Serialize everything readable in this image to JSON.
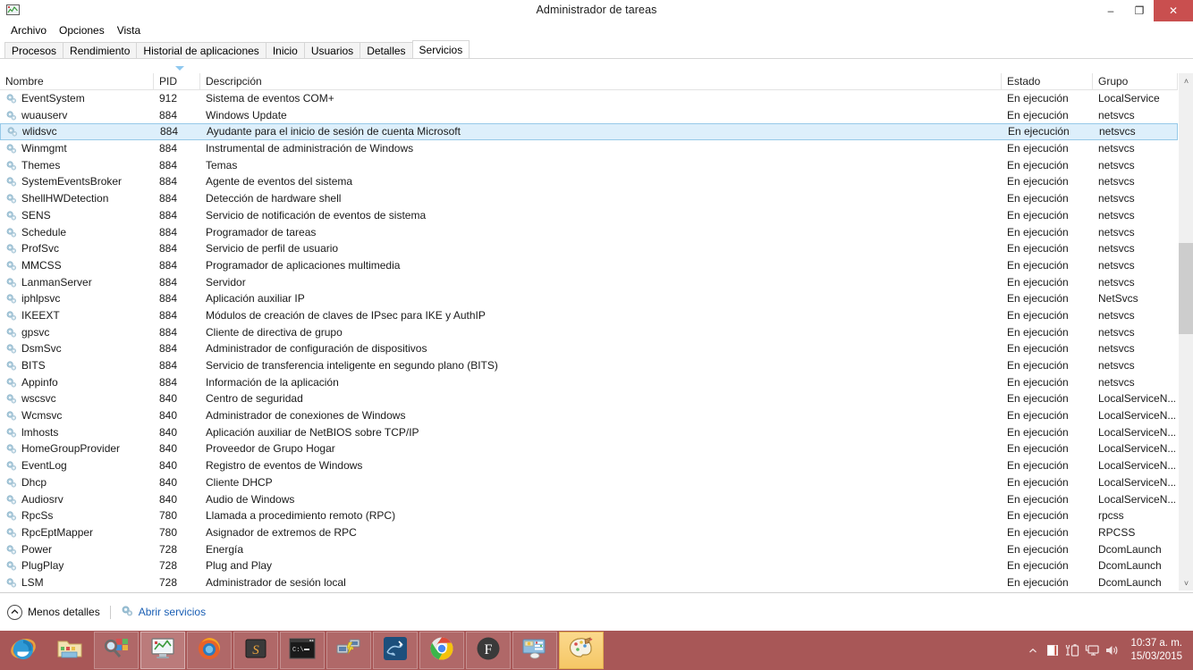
{
  "window": {
    "title": "Administrador de tareas",
    "icon": "task-manager-icon",
    "minimize_label": "–",
    "maximize_label": "❐",
    "close_label": "✕"
  },
  "menubar": {
    "items": [
      {
        "label": "Archivo"
      },
      {
        "label": "Opciones"
      },
      {
        "label": "Vista"
      }
    ]
  },
  "tabs": [
    {
      "label": "Procesos",
      "active": false
    },
    {
      "label": "Rendimiento",
      "active": false
    },
    {
      "label": "Historial de aplicaciones",
      "active": false
    },
    {
      "label": "Inicio",
      "active": false
    },
    {
      "label": "Usuarios",
      "active": false
    },
    {
      "label": "Detalles",
      "active": false
    },
    {
      "label": "Servicios",
      "active": true
    }
  ],
  "table": {
    "columns": [
      {
        "key": "name",
        "label": "Nombre"
      },
      {
        "key": "pid",
        "label": "PID"
      },
      {
        "key": "desc",
        "label": "Descripción"
      },
      {
        "key": "state",
        "label": "Estado"
      },
      {
        "key": "group",
        "label": "Grupo"
      }
    ],
    "sort": {
      "column": "PID",
      "direction": "descending"
    },
    "rows": [
      {
        "name": "EventSystem",
        "pid": "912",
        "desc": "Sistema de eventos COM+",
        "state": "En ejecución",
        "group": "LocalService",
        "selected": false
      },
      {
        "name": "wuauserv",
        "pid": "884",
        "desc": "Windows Update",
        "state": "En ejecución",
        "group": "netsvcs",
        "selected": false
      },
      {
        "name": "wlidsvc",
        "pid": "884",
        "desc": "Ayudante para el inicio de sesión de cuenta Microsoft",
        "state": "En ejecución",
        "group": "netsvcs",
        "selected": true
      },
      {
        "name": "Winmgmt",
        "pid": "884",
        "desc": "Instrumental de administración de Windows",
        "state": "En ejecución",
        "group": "netsvcs",
        "selected": false
      },
      {
        "name": "Themes",
        "pid": "884",
        "desc": "Temas",
        "state": "En ejecución",
        "group": "netsvcs",
        "selected": false
      },
      {
        "name": "SystemEventsBroker",
        "pid": "884",
        "desc": "Agente de eventos del sistema",
        "state": "En ejecución",
        "group": "netsvcs",
        "selected": false
      },
      {
        "name": "ShellHWDetection",
        "pid": "884",
        "desc": "Detección de hardware shell",
        "state": "En ejecución",
        "group": "netsvcs",
        "selected": false
      },
      {
        "name": "SENS",
        "pid": "884",
        "desc": "Servicio de notificación de eventos de sistema",
        "state": "En ejecución",
        "group": "netsvcs",
        "selected": false
      },
      {
        "name": "Schedule",
        "pid": "884",
        "desc": "Programador de tareas",
        "state": "En ejecución",
        "group": "netsvcs",
        "selected": false
      },
      {
        "name": "ProfSvc",
        "pid": "884",
        "desc": "Servicio de perfil de usuario",
        "state": "En ejecución",
        "group": "netsvcs",
        "selected": false
      },
      {
        "name": "MMCSS",
        "pid": "884",
        "desc": "Programador de aplicaciones multimedia",
        "state": "En ejecución",
        "group": "netsvcs",
        "selected": false
      },
      {
        "name": "LanmanServer",
        "pid": "884",
        "desc": "Servidor",
        "state": "En ejecución",
        "group": "netsvcs",
        "selected": false
      },
      {
        "name": "iphlpsvc",
        "pid": "884",
        "desc": "Aplicación auxiliar IP",
        "state": "En ejecución",
        "group": "NetSvcs",
        "selected": false
      },
      {
        "name": "IKEEXT",
        "pid": "884",
        "desc": "Módulos de creación de claves de IPsec para IKE y AuthIP",
        "state": "En ejecución",
        "group": "netsvcs",
        "selected": false
      },
      {
        "name": "gpsvc",
        "pid": "884",
        "desc": "Cliente de directiva de grupo",
        "state": "En ejecución",
        "group": "netsvcs",
        "selected": false
      },
      {
        "name": "DsmSvc",
        "pid": "884",
        "desc": "Administrador de configuración de dispositivos",
        "state": "En ejecución",
        "group": "netsvcs",
        "selected": false
      },
      {
        "name": "BITS",
        "pid": "884",
        "desc": "Servicio de transferencia inteligente en segundo plano (BITS)",
        "state": "En ejecución",
        "group": "netsvcs",
        "selected": false
      },
      {
        "name": "Appinfo",
        "pid": "884",
        "desc": "Información de la aplicación",
        "state": "En ejecución",
        "group": "netsvcs",
        "selected": false
      },
      {
        "name": "wscsvc",
        "pid": "840",
        "desc": "Centro de seguridad",
        "state": "En ejecución",
        "group": "LocalServiceN...",
        "selected": false
      },
      {
        "name": "Wcmsvc",
        "pid": "840",
        "desc": "Administrador de conexiones de Windows",
        "state": "En ejecución",
        "group": "LocalServiceN...",
        "selected": false
      },
      {
        "name": "lmhosts",
        "pid": "840",
        "desc": "Aplicación auxiliar de NetBIOS sobre TCP/IP",
        "state": "En ejecución",
        "group": "LocalServiceN...",
        "selected": false
      },
      {
        "name": "HomeGroupProvider",
        "pid": "840",
        "desc": "Proveedor de Grupo Hogar",
        "state": "En ejecución",
        "group": "LocalServiceN...",
        "selected": false
      },
      {
        "name": "EventLog",
        "pid": "840",
        "desc": "Registro de eventos de Windows",
        "state": "En ejecución",
        "group": "LocalServiceN...",
        "selected": false
      },
      {
        "name": "Dhcp",
        "pid": "840",
        "desc": "Cliente DHCP",
        "state": "En ejecución",
        "group": "LocalServiceN...",
        "selected": false
      },
      {
        "name": "Audiosrv",
        "pid": "840",
        "desc": "Audio de Windows",
        "state": "En ejecución",
        "group": "LocalServiceN...",
        "selected": false
      },
      {
        "name": "RpcSs",
        "pid": "780",
        "desc": "Llamada a procedimiento remoto (RPC)",
        "state": "En ejecución",
        "group": "rpcss",
        "selected": false
      },
      {
        "name": "RpcEptMapper",
        "pid": "780",
        "desc": "Asignador de extremos de RPC",
        "state": "En ejecución",
        "group": "RPCSS",
        "selected": false
      },
      {
        "name": "Power",
        "pid": "728",
        "desc": "Energía",
        "state": "En ejecución",
        "group": "DcomLaunch",
        "selected": false
      },
      {
        "name": "PlugPlay",
        "pid": "728",
        "desc": "Plug and Play",
        "state": "En ejecución",
        "group": "DcomLaunch",
        "selected": false
      },
      {
        "name": "LSM",
        "pid": "728",
        "desc": "Administrador de sesión local",
        "state": "En ejecución",
        "group": "DcomLaunch",
        "selected": false
      }
    ]
  },
  "scrollbar": {
    "up_arrow": "˄",
    "down_arrow": "˅"
  },
  "statusbar": {
    "less_details_label": "Menos detalles",
    "less_details_icon": "chevron-up-icon",
    "open_services_label": "Abrir servicios",
    "open_services_icon": "services-gear-icon"
  },
  "taskbar": {
    "buttons": [
      {
        "name": "internet-explorer",
        "state": "pinned"
      },
      {
        "name": "file-explorer",
        "state": "pinned"
      },
      {
        "name": "search-windows",
        "state": "open"
      },
      {
        "name": "task-manager",
        "state": "active"
      },
      {
        "name": "firefox",
        "state": "open"
      },
      {
        "name": "sublime-text",
        "state": "open"
      },
      {
        "name": "command-prompt",
        "state": "open"
      },
      {
        "name": "network-tool",
        "state": "open"
      },
      {
        "name": "wireshark",
        "state": "open"
      },
      {
        "name": "google-chrome",
        "state": "open"
      },
      {
        "name": "foxit-reader",
        "state": "open"
      },
      {
        "name": "control-panel",
        "state": "open"
      },
      {
        "name": "paint",
        "state": "active"
      }
    ],
    "tray": {
      "show_hidden_icon": "chevron-up-icon",
      "icons": [
        {
          "name": "flag-action-center-icon"
        },
        {
          "name": "battery-icon"
        },
        {
          "name": "network-icon"
        },
        {
          "name": "volume-icon"
        }
      ],
      "time": "10:37 a. m.",
      "date": "15/03/2015"
    }
  },
  "colors": {
    "selection": "#ddeffb",
    "selection_border": "#96c9e8",
    "close_button": "#c94f4f",
    "taskbar": "#a85757",
    "link": "#1a5fb4"
  }
}
